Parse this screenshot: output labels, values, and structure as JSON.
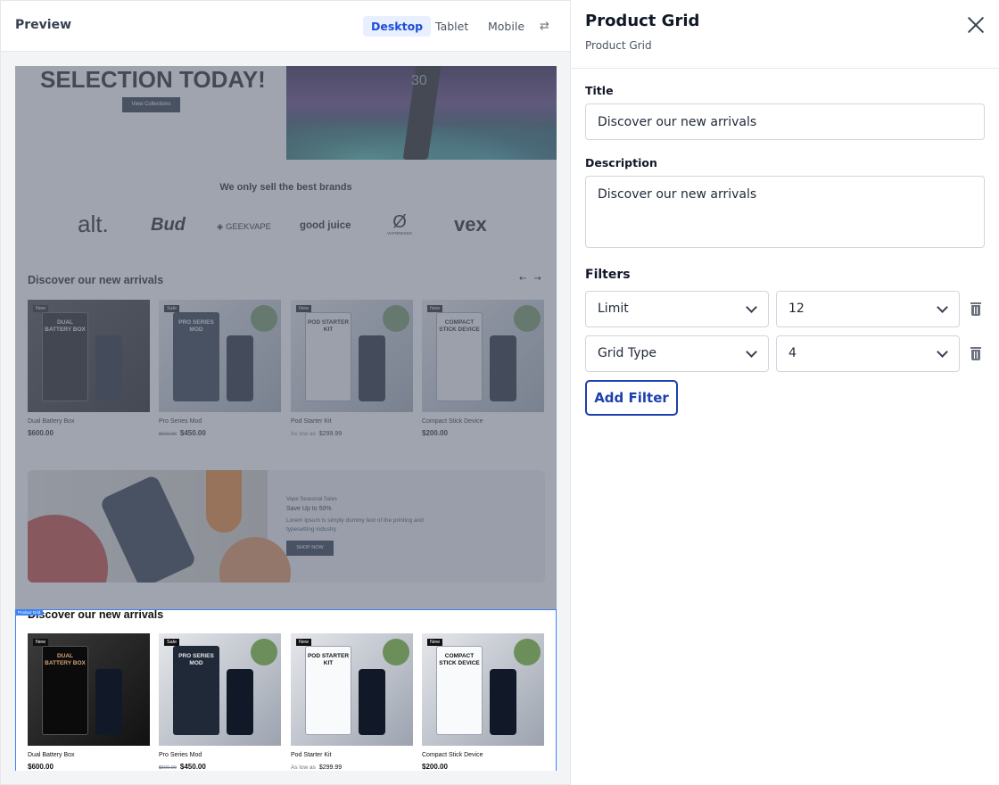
{
  "preview": {
    "title": "Preview",
    "devices": [
      "Desktop",
      "Tablet",
      "Mobile"
    ],
    "active_device": "Desktop",
    "page": {
      "hero_title": "SELECTION TODAY!",
      "hero_button": "View Collections",
      "hero_display_number": "30",
      "brands_title": "We only sell the best brands",
      "brands": [
        "alt.",
        "Bud",
        "GEEKVAPE",
        "good juice",
        "VAPORESSO",
        "vex"
      ],
      "section_title": "Discover our new arrivals",
      "products": [
        {
          "name": "Dual Battery Box",
          "badge": "New",
          "box_label": "DUAL BATTERY BOX",
          "price": "$600.00",
          "old_price": "",
          "prefix": ""
        },
        {
          "name": "Pro Series Mod",
          "badge": "Sale",
          "box_label": "PRO SERIES MOD",
          "price": "$450.00",
          "old_price": "$500.00",
          "prefix": ""
        },
        {
          "name": "Pod Starter Kit",
          "badge": "New",
          "box_label": "POD STARTER KIT",
          "price": "$299.99",
          "old_price": "",
          "prefix": "As low as"
        },
        {
          "name": "Compact Stick Device",
          "badge": "New",
          "box_label": "COMPACT STICK DEVICE",
          "price": "$200.00",
          "old_price": "",
          "prefix": ""
        }
      ],
      "promo": {
        "kicker": "Vape Seasonal Sales",
        "headline": "Save Up to 50%",
        "text": "Lorem Ipsum is simply dummy text of the printing and typesetting industry",
        "button": "SHOP NOW"
      },
      "selected_block_tag": "Product Grid",
      "selected_section_title": "Discover our new arrivals"
    }
  },
  "editor": {
    "title": "Product Grid",
    "subtitle": "Product Grid",
    "title_label": "Title",
    "title_value": "Discover our new arrivals",
    "description_label": "Description",
    "description_value": "Discover our new arrivals",
    "filters_label": "Filters",
    "filters": [
      {
        "key": "Limit",
        "value": "12"
      },
      {
        "key": "Grid Type",
        "value": "4"
      }
    ],
    "add_filter_label": "Add Filter"
  },
  "colors": {
    "accent": "#1d4ed8",
    "selection": "#3b82f6",
    "overlay": "#646c7c"
  }
}
